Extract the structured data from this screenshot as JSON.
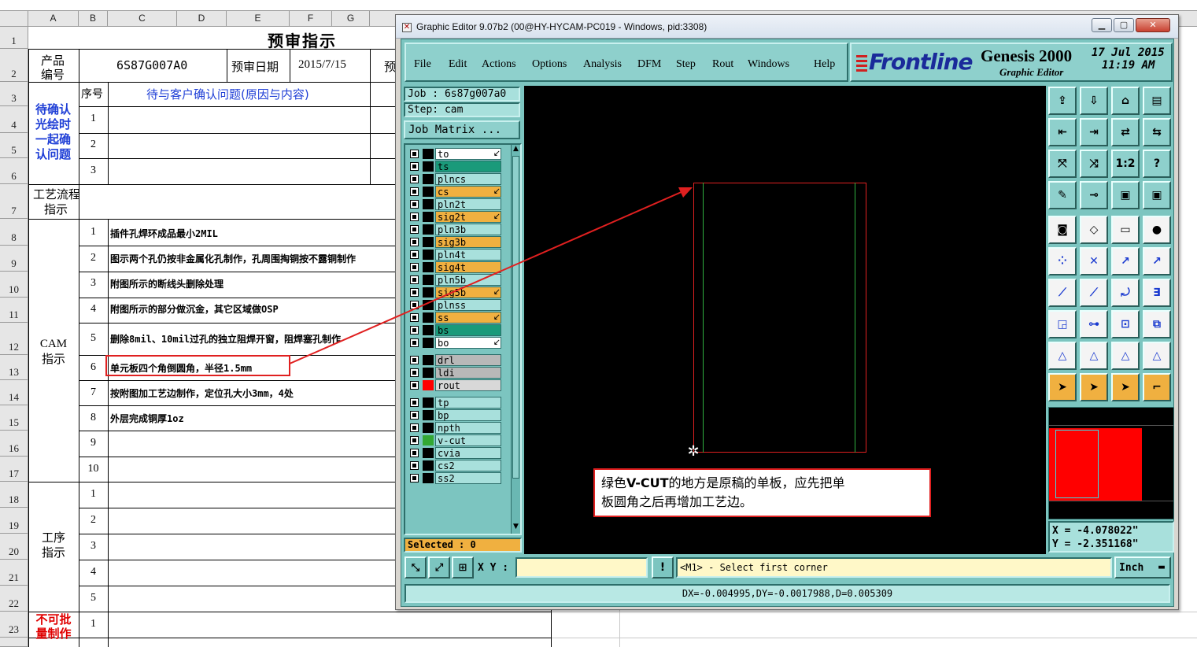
{
  "sheet": {
    "columns": [
      "A",
      "B",
      "C",
      "D",
      "E",
      "F",
      "G"
    ],
    "rows": [
      "1",
      "2",
      "3",
      "4",
      "5",
      "6",
      "7",
      "8",
      "9",
      "10",
      "11",
      "12",
      "13",
      "14",
      "15",
      "16",
      "17",
      "18",
      "19",
      "20",
      "21",
      "22",
      "23"
    ],
    "title": "预审指示",
    "product_label_1": "产品",
    "product_label_2": "编号",
    "product_no": "6S87G007A0",
    "review_date_label": "预审日期",
    "review_date": "2015/7/15",
    "review_cut": "预",
    "seq_label": "序号",
    "customer_issue_header": "待与客户确认问题(原因与内容)",
    "confirm_group": [
      "待确认",
      "光绘时",
      "一起确",
      "认问题"
    ],
    "confirm_nums": [
      "1",
      "2",
      "3"
    ],
    "process_label_1": "工艺流程",
    "process_label_2": "指示",
    "cam_label_1": "CAM",
    "cam_label_2": "指示",
    "cam_nums": [
      "1",
      "2",
      "3",
      "4",
      "5",
      "6",
      "7",
      "8",
      "9",
      "10"
    ],
    "cam_items": [
      "插件孔焊环成品最小2MIL",
      "图示两个孔仍按非金属化孔制作，孔周围掏铜按不露铜制作",
      "附图所示的断线头删除处理",
      "附图所示的部分做沉金，其它区域做OSP",
      "删除8mil、10mil过孔的独立阻焊开窗，阻焊塞孔制作",
      "单元板四个角倒圆角，半径1.5mm",
      "按附图加工艺边制作，定位孔大小3mm，4处",
      "外层完成铜厚1oz"
    ],
    "step_label_1": "工序",
    "step_label_2": "指示",
    "step_nums": [
      "1",
      "2",
      "3",
      "4",
      "5"
    ],
    "nobatch_label_1": "不可批",
    "nobatch_label_2": "量制作",
    "nobatch_num": "1"
  },
  "editor": {
    "title": "Graphic Editor 9.07b2 (00@HY-HYCAM-PC019 - Windows, pid:3308)",
    "menus": [
      "File",
      "Edit",
      "Actions",
      "Options",
      "Analysis",
      "DFM",
      "Step",
      "Rout",
      "Windows",
      "Help"
    ],
    "brand": "Frontline",
    "product": "Genesis 2000",
    "subtitle": "Graphic Editor",
    "date": "17 Jul 2015",
    "time": "11:19 AM",
    "job": "Job : 6s87g007a0",
    "step": "Step: cam",
    "job_matrix": "Job Matrix ...",
    "selected": "Selected : 0",
    "coord_x": "X = -4.078022\"",
    "coord_y": "Y = -2.351168\"",
    "xy_label": "X Y :",
    "xy_value": "",
    "prompt": "<M1> - Select first corner",
    "units": "Inch",
    "status": "DX=-0.004995,DY=-0.0017988,D=0.005309",
    "layers": [
      {
        "name": "to",
        "color": "#000000",
        "bg": "#ffffff",
        "arrow": true
      },
      {
        "name": "ts",
        "color": "#000000",
        "bg": "#1a9a7a",
        "arrow": false
      },
      {
        "name": "plncs",
        "color": "#000000",
        "bg": "#a8e0dc",
        "arrow": false
      },
      {
        "name": "cs",
        "color": "#000000",
        "bg": "#f0b040",
        "arrow": true
      },
      {
        "name": "pln2t",
        "color": "#000000",
        "bg": "#a8e0dc",
        "arrow": false
      },
      {
        "name": "sig2t",
        "color": "#000000",
        "bg": "#f0b040",
        "arrow": true
      },
      {
        "name": "pln3b",
        "color": "#000000",
        "bg": "#a8e0dc",
        "arrow": false
      },
      {
        "name": "sig3b",
        "color": "#000000",
        "bg": "#f0b040",
        "arrow": false
      },
      {
        "name": "pln4t",
        "color": "#000000",
        "bg": "#a8e0dc",
        "arrow": false
      },
      {
        "name": "sig4t",
        "color": "#000000",
        "bg": "#f0b040",
        "arrow": false
      },
      {
        "name": "pln5b",
        "color": "#000000",
        "bg": "#a8e0dc",
        "arrow": false
      },
      {
        "name": "sig5b",
        "color": "#000000",
        "bg": "#f0b040",
        "arrow": true
      },
      {
        "name": "plnss",
        "color": "#000000",
        "bg": "#a8e0dc",
        "arrow": false
      },
      {
        "name": "ss",
        "color": "#000000",
        "bg": "#f0b040",
        "arrow": true
      },
      {
        "name": "bs",
        "color": "#000000",
        "bg": "#1a9a7a",
        "arrow": false
      },
      {
        "name": "bo",
        "color": "#000000",
        "bg": "#ffffff",
        "arrow": true
      },
      {
        "name": "drl",
        "color": "#000000",
        "bg": "#b8b8b8",
        "arrow": false
      },
      {
        "name": "ldi",
        "color": "#000000",
        "bg": "#b8b8b8",
        "arrow": false
      },
      {
        "name": "rout",
        "color": "#ff0000",
        "bg": "#d8d8d8",
        "arrow": false
      },
      {
        "name": "tp",
        "color": "#000000",
        "bg": "#a8e0dc",
        "arrow": false
      },
      {
        "name": "bp",
        "color": "#000000",
        "bg": "#a8e0dc",
        "arrow": false
      },
      {
        "name": "npth",
        "color": "#000000",
        "bg": "#a8e0dc",
        "arrow": false
      },
      {
        "name": "v-cut",
        "color": "#33a833",
        "bg": "#a8e0dc",
        "arrow": false
      },
      {
        "name": "cvia",
        "color": "#000000",
        "bg": "#a8e0dc",
        "arrow": false
      },
      {
        "name": "cs2",
        "color": "#000000",
        "bg": "#a8e0dc",
        "arrow": false
      },
      {
        "name": "ss2",
        "color": "#000000",
        "bg": "#a8e0dc",
        "arrow": false
      }
    ]
  },
  "annotation": {
    "line1_a": "绿色",
    "line1_b": "V-CUT",
    "line1_c": "的地方是原稿的单板，应先把单",
    "line2": "板圆角之后再增加工艺边。"
  },
  "colors": {
    "accent_red": "#ff0000",
    "lcd_bg": "#a8e0dc",
    "panel_teal": "#7cc5c0",
    "blue_text": "#1f3fd6"
  }
}
